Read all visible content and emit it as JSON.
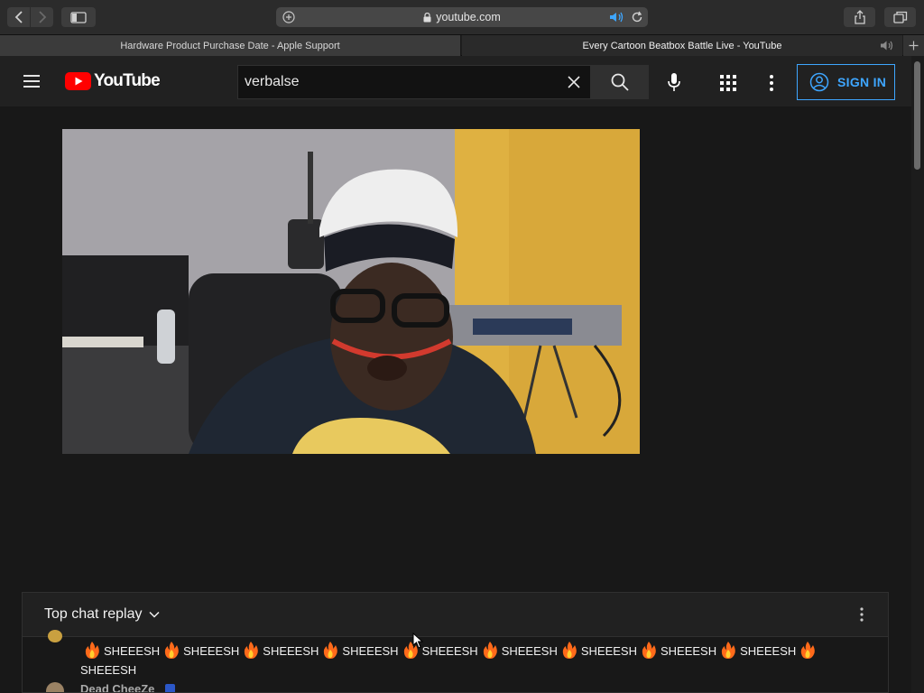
{
  "browser": {
    "address": "youtube.com",
    "tabs": [
      {
        "title": "Hardware Product Purchase Date - Apple Support",
        "active": false
      },
      {
        "title": "Every Cartoon Beatbox Battle Live - YouTube",
        "active": true
      }
    ]
  },
  "header": {
    "logo_text": "YouTube",
    "search_value": "verbalse",
    "signin_label": "SIGN IN"
  },
  "colors": {
    "accent": "#3ea6ff",
    "brand_red": "#ff0000",
    "background": "#181818"
  },
  "chat": {
    "title": "Top chat replay",
    "message_line1": "SHEEESH SHEEESH SHEEESH SHEEESH SHEEESH SHEEESH SHEEESH SHEEESH SHEEESH",
    "word": "SHEEESH",
    "next_author": "Dead CheeZe"
  }
}
